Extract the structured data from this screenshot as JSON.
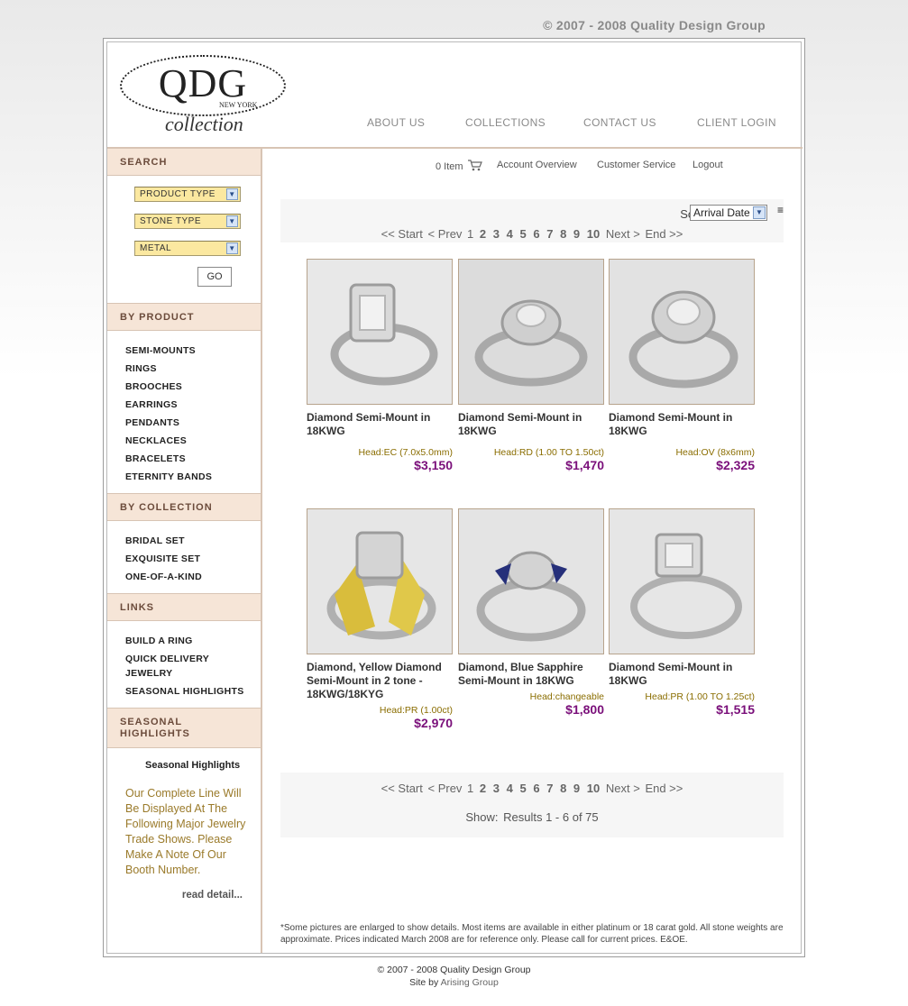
{
  "top_copyright": "© 2007 - 2008 Quality Design Group",
  "logo": {
    "main": "QDG",
    "sub": "NEW YORK",
    "tagline": "collection"
  },
  "topnav": [
    "ABOUT US",
    "COLLECTIONS",
    "CONTACT US",
    "CLIENT LOGIN"
  ],
  "sidebar": {
    "search": {
      "heading": "SEARCH",
      "dropdowns": [
        "PRODUCT TYPE",
        "STONE TYPE",
        "METAL"
      ],
      "go": "GO"
    },
    "by_product": {
      "heading": "BY PRODUCT",
      "items": [
        "SEMI-MOUNTS",
        "RINGS",
        "BROOCHES",
        "EARRINGS",
        "PENDANTS",
        "NECKLACES",
        "BRACELETS",
        "ETERNITY BANDS"
      ]
    },
    "by_collection": {
      "heading": "BY COLLECTION",
      "items": [
        "BRIDAL SET",
        "EXQUISITE SET",
        "ONE-OF-A-KIND"
      ]
    },
    "links": {
      "heading": "LINKS",
      "items": [
        "BUILD A RING",
        "QUICK DELIVERY",
        "JEWELRY",
        "SEASONAL HIGHLIGHTS"
      ]
    },
    "seasonal": {
      "heading_line1": "SEASONAL",
      "heading_line2": "HIGHLIGHTS",
      "title": "Seasonal Highlights",
      "text": "Our Complete Line Will Be Displayed At The Following Major Jewelry Trade Shows. Please Make A Note Of Our Booth Number.",
      "read_more": "read detail..."
    }
  },
  "account_bar": {
    "cart": "0 Item",
    "links": [
      "Account Overview",
      "Customer Service",
      "Logout"
    ]
  },
  "sort": {
    "label": "Sort by:",
    "value": "Arrival Date"
  },
  "pager": {
    "start": "<< Start",
    "prev": "< Prev",
    "pages": [
      "1",
      "2",
      "3",
      "4",
      "5",
      "6",
      "7",
      "8",
      "9",
      "10"
    ],
    "next": "Next >",
    "end": "End >>"
  },
  "products": [
    {
      "name": "Diamond Semi-Mount in 18KWG",
      "head": "Head:EC (7.0x5.0mm)",
      "price": "$3,150"
    },
    {
      "name": "Diamond Semi-Mount in 18KWG",
      "head": "Head:RD (1.00 TO 1.50ct)",
      "price": "$1,470"
    },
    {
      "name": "Diamond Semi-Mount in 18KWG",
      "head": "Head:OV (8x6mm)",
      "price": "$2,325"
    },
    {
      "name": "Diamond, Yellow Diamond Semi-Mount in 2 tone - 18KWG/18KYG",
      "head": "Head:PR (1.00ct)",
      "price": "$2,970"
    },
    {
      "name": "Diamond, Blue Sapphire Semi-Mount in 18KWG",
      "head": "Head:changeable",
      "price": "$1,800"
    },
    {
      "name": "Diamond Semi-Mount in 18KWG",
      "head": "Head:PR (1.00 TO 1.25ct)",
      "price": "$1,515"
    }
  ],
  "results": {
    "label": "Show:",
    "text": "Results 1 - 6 of 75"
  },
  "disclaimer": "*Some pictures are enlarged to show details. Most items are available in either platinum or 18 carat gold. All stone weights are approximate. Prices indicated March 2008 are for reference only. Please call for current prices. E&OE.",
  "footer": {
    "copyright": "© 2007 - 2008 Quality Design Group",
    "site_by": "Site by",
    "site_by_name": "Arising Group"
  }
}
